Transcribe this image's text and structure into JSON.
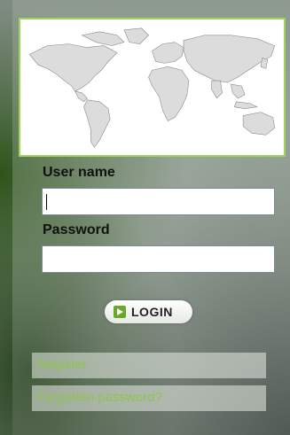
{
  "form": {
    "username_label": "User name",
    "username_value": "",
    "password_label": "Password",
    "password_value": ""
  },
  "login_button": {
    "label": "LOGIN",
    "icon": "arrow-right-icon"
  },
  "links": {
    "register": "Register",
    "forgot_password": "Forgotten password?"
  },
  "colors": {
    "accent_green": "#8fc54c",
    "map_border": "#9fd45b"
  }
}
